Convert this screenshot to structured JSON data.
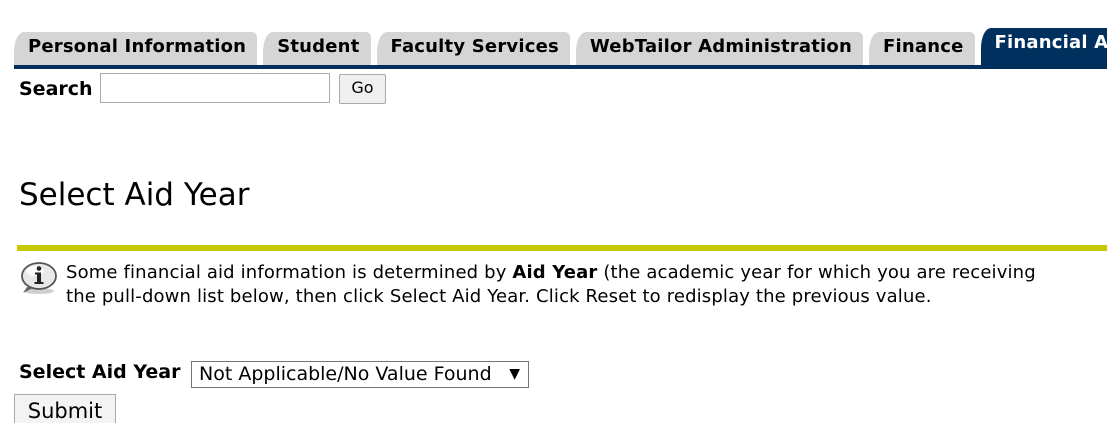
{
  "tabs": [
    {
      "label": "Personal Information",
      "active": false
    },
    {
      "label": "Student",
      "active": false
    },
    {
      "label": "Faculty Services",
      "active": false
    },
    {
      "label": "WebTailor Administration",
      "active": false
    },
    {
      "label": "Finance",
      "active": false
    },
    {
      "label": "Financial Aid",
      "active": true
    }
  ],
  "search": {
    "label": "Search",
    "value": "",
    "button_label": "Go"
  },
  "page": {
    "title": "Select Aid Year"
  },
  "info": {
    "icon": "info-icon",
    "text_before": "Some financial aid information is determined by ",
    "text_bold": "Aid Year",
    "text_after_line1": " (the academic year for which you are receiving",
    "text_line2": "the pull-down list below, then click Select Aid Year. Click Reset to redisplay the previous value."
  },
  "form": {
    "select_label": "Select Aid Year",
    "select_value": "Not Applicable/No Value Found",
    "submit_label": "Submit"
  },
  "colors": {
    "tab_active": "#00305e",
    "tab_inactive": "#d5d5d5",
    "title_rule": "#c8c800"
  }
}
